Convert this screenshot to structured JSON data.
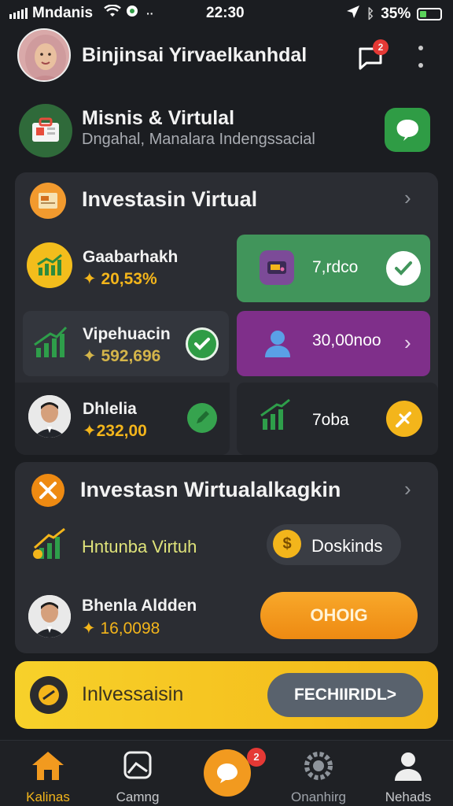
{
  "status_bar": {
    "carrier": "Mndanis",
    "time": "22:30",
    "battery": "35%",
    "battery_level": 0.35
  },
  "header": {
    "title": "Binjinsai Yirvaelkanhdal",
    "notif_count": "2"
  },
  "profile": {
    "title": "Misnis & Virtulal",
    "subtitle": "Dngahal, Manalara Indengssacial"
  },
  "section1": {
    "title": "Investasin Virtual",
    "items": [
      {
        "name": "Gaabarhakh",
        "value": "20,53%"
      },
      {
        "name": "Vipehuacin",
        "value": "592,696"
      },
      {
        "name": "Dhlelia",
        "value": "232,00"
      }
    ],
    "tiles": {
      "green_text": "7,rdco",
      "purple_text": "30,00noo",
      "dark_text": "7oba"
    }
  },
  "section2": {
    "title": "Investasn Wirtualalkagkin",
    "item_label": "Hntunba Virtuh",
    "pill_label": "Doskinds",
    "person_name": "Bhenla Aldden",
    "person_value": "16,0098",
    "orange_button": "OHOIG"
  },
  "banner": {
    "label": "Inlvessaisin",
    "button": "FECHIIRIDL>"
  },
  "nav": [
    {
      "label": "Kalinas"
    },
    {
      "label": "Camng"
    },
    {
      "label": ""
    },
    {
      "label": "Onanhirg"
    },
    {
      "label": "Nehads"
    }
  ],
  "nav_badge": "2",
  "colors": {
    "accent_yellow": "#f3b51b",
    "accent_orange": "#ee8a12",
    "green": "#41955b",
    "purple": "#7f2f8a",
    "badge_red": "#e53935"
  }
}
